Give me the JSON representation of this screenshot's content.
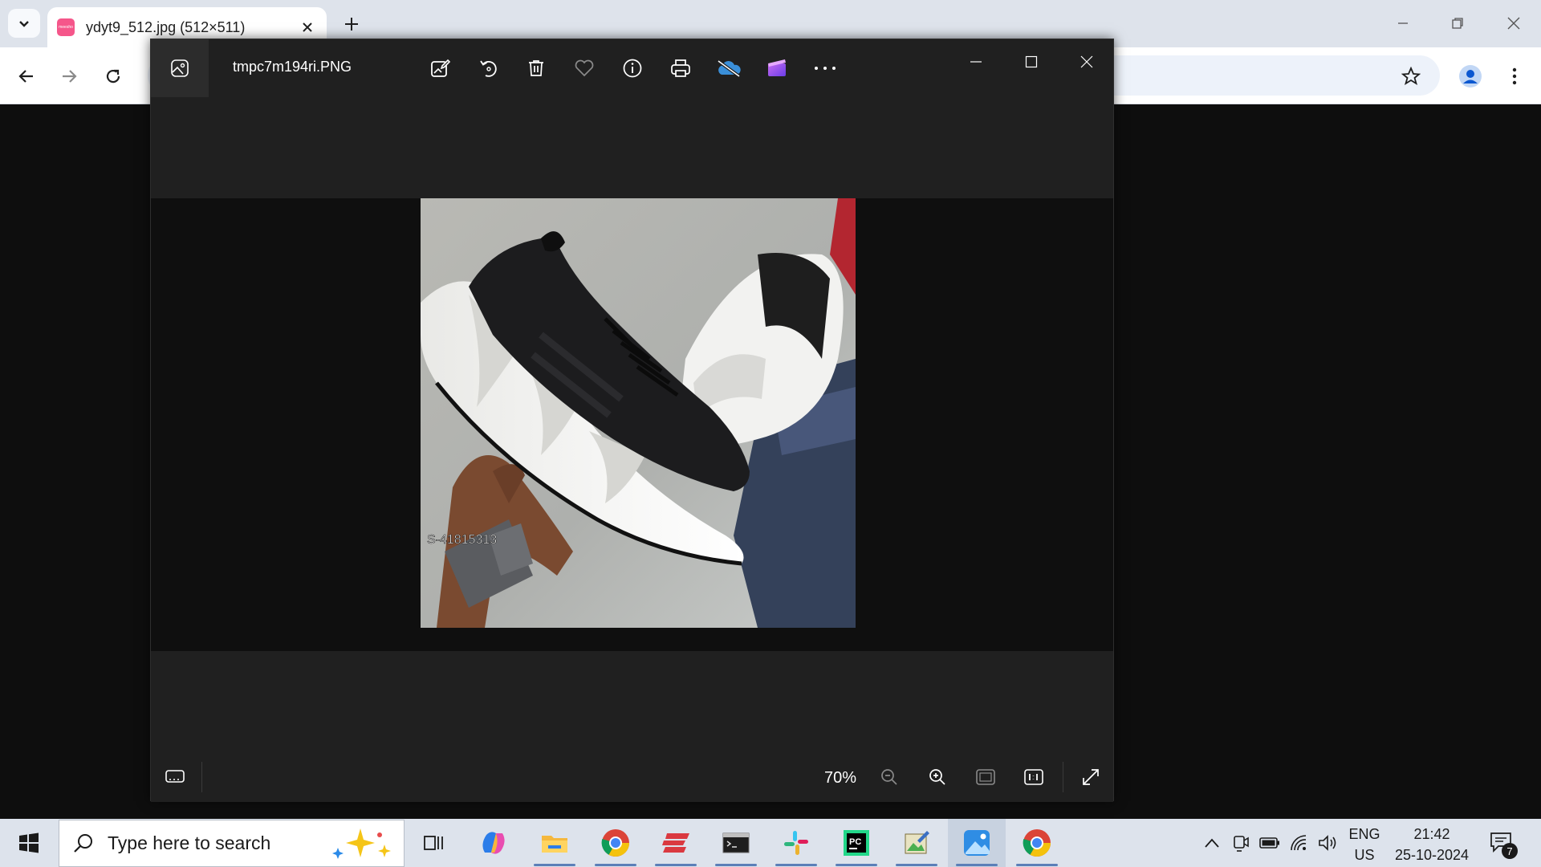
{
  "browser": {
    "tab_title": "ydyt9_512.jpg (512×511)",
    "tab_favicon_text": "meesho"
  },
  "photos": {
    "file_name": "tmpc7m194ri.PNG",
    "zoom_level": "70%",
    "image_watermark": "S-41815313",
    "toolbar": [
      "edit-image-icon",
      "rotate-icon",
      "delete-icon",
      "favorite-icon",
      "info-icon",
      "print-icon",
      "onedrive-icon",
      "clipchamp-icon",
      "more-icon"
    ]
  },
  "taskbar": {
    "search_placeholder": "Type here to search",
    "lang_top": "ENG",
    "lang_bottom": "US",
    "time": "21:42",
    "date": "25-10-2024",
    "notification_count": "7"
  },
  "colors": {
    "viewer_bg": "#202020",
    "canvas_bg": "#0f0f0f",
    "taskbar_bg": "#dde3ec",
    "tab_favicon": "#f5568a"
  }
}
